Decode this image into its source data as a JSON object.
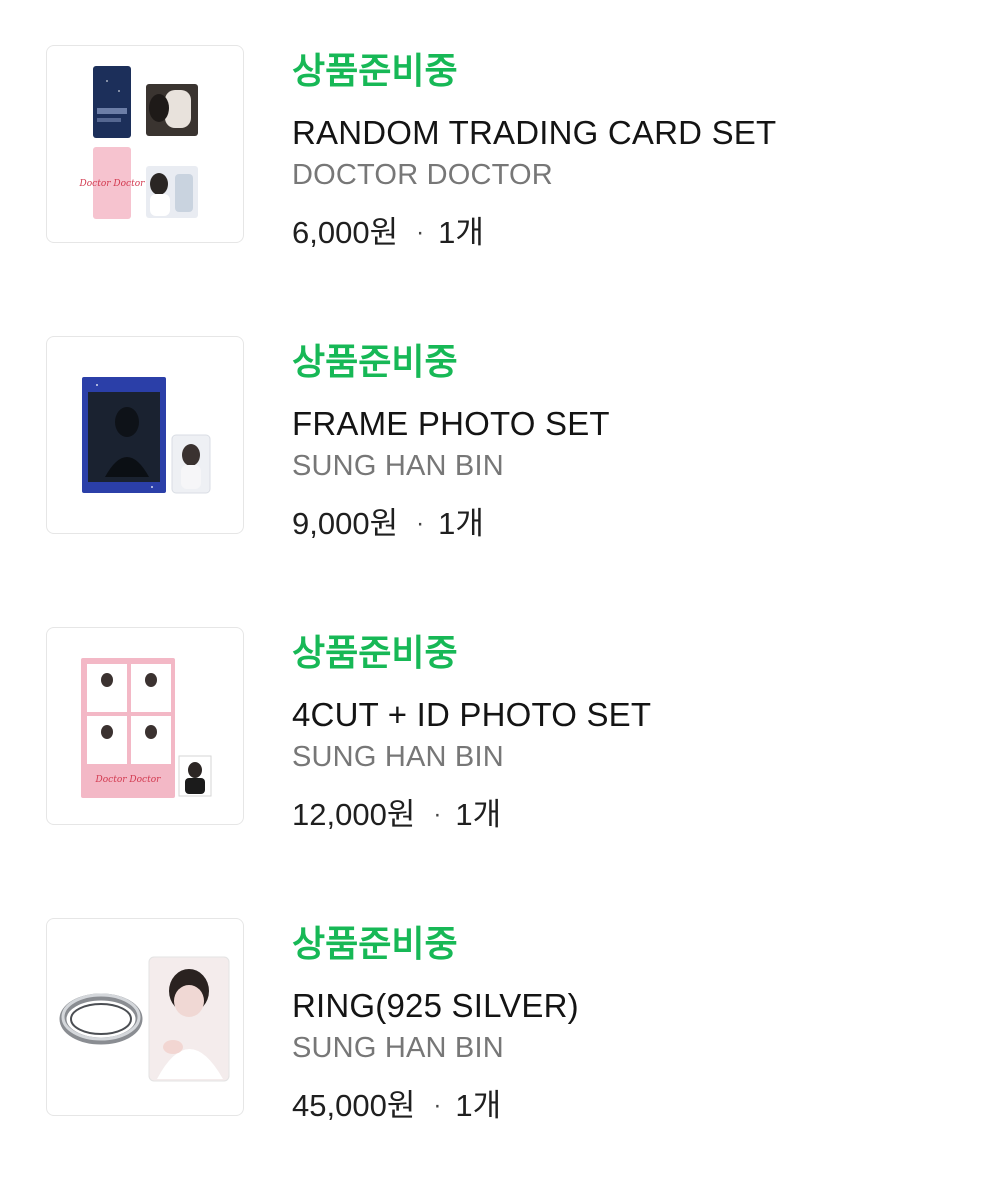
{
  "items": [
    {
      "status": "상품준비중",
      "title": "RANDOM TRADING CARD SET",
      "artist": "DOCTOR DOCTOR",
      "price": "6,000원",
      "separator": "·",
      "quantity": "1개",
      "image_text": "Doctor Doctor"
    },
    {
      "status": "상품준비중",
      "title": "FRAME PHOTO SET",
      "artist": "SUNG HAN BIN",
      "price": "9,000원",
      "separator": "·",
      "quantity": "1개"
    },
    {
      "status": "상품준비중",
      "title": "4CUT + ID PHOTO SET",
      "artist": "SUNG HAN BIN",
      "price": "12,000원",
      "separator": "·",
      "quantity": "1개",
      "image_text": "Doctor Doctor"
    },
    {
      "status": "상품준비중",
      "title": "RING(925 SILVER)",
      "artist": "SUNG HAN BIN",
      "price": "45,000원",
      "separator": "·",
      "quantity": "1개"
    }
  ],
  "colors": {
    "status_green": "#17b856",
    "artist_gray": "#777777",
    "border": "#e6e6e6"
  }
}
